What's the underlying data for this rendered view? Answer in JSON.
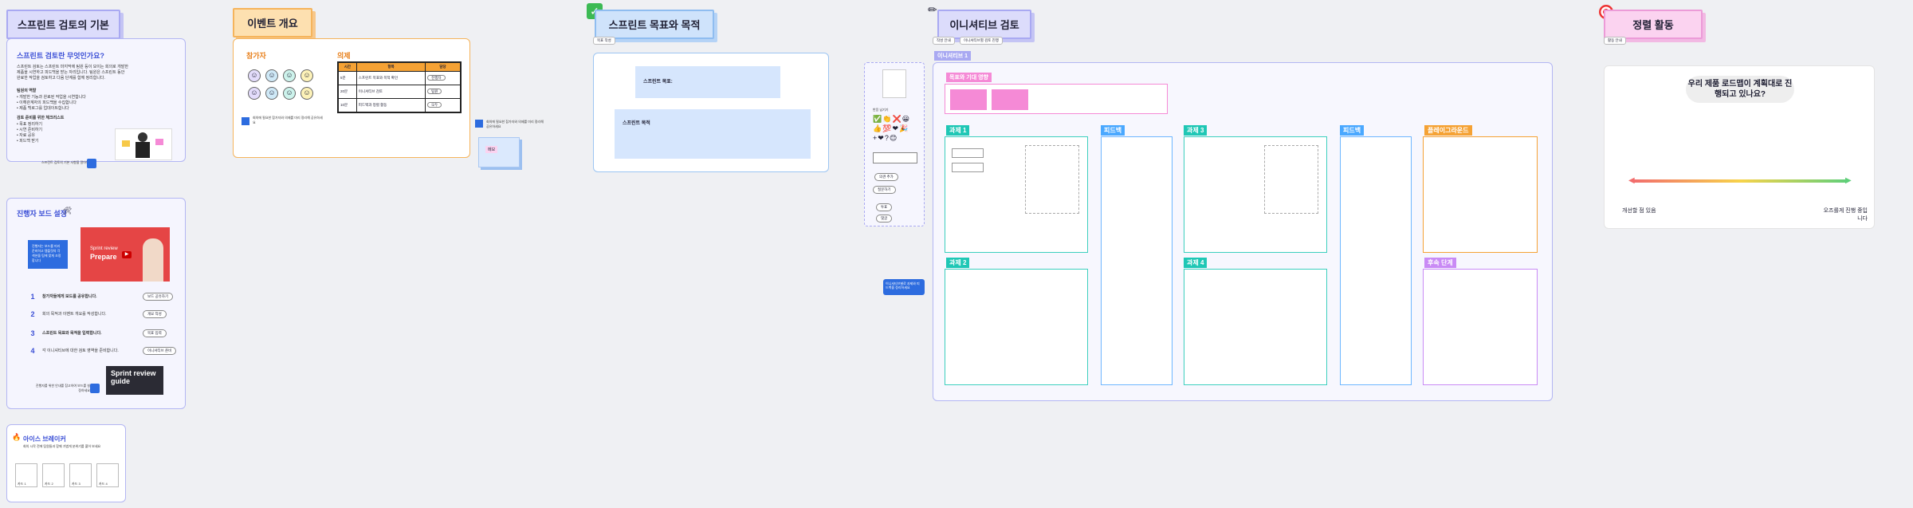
{
  "sections": {
    "basics": {
      "title": "스프린트 검토의 기본",
      "what_title": "스프린트 검토란 무엇인가요?",
      "what_body": "스프린트 검토는 스프린트 마지막에 팀원 등이 모이는 회의로 개발한 제품을 시연하고 피드백을 받는 자리입니다. 팀원은 스프린트 동안 완료한 작업을 검토하고 다음 단계를 함께 정리합니다.",
      "roles_title": "팀원의 역할",
      "roles_body": "• 개발한 기능과 완료된 작업을 시연합니다\n• 이해관계자의 피드백을 수집합니다\n• 제품 백로그를 업데이트합니다",
      "prep_title": "검토 준비를 위한 체크리스트",
      "prep_items": [
        "• 목표 정리하기",
        "• 시연 준비하기",
        "• 자료 공유",
        "• 피드백 받기"
      ],
      "hint": "스프린트 검토의 기본 사항을 알아보세요"
    },
    "facilitator": {
      "title": "진행자 보드 설정",
      "video_sub": "Sprint review",
      "video_main": "Prepare",
      "blue_note": "진행자는 보드를 미리 준비하고 템플릿의 각 섹션을 팀에 맞게 조정합니다",
      "steps": [
        {
          "n": "1",
          "text": "참가자들에게 보드를 공유합니다.",
          "btn": "보드 공유하기"
        },
        {
          "n": "2",
          "text": "회의 목적과 이벤트 개요를 작성합니다.",
          "btn": "개요 작성"
        },
        {
          "n": "3",
          "text": "스프린트 목표와 목적을 입력합니다.",
          "btn": "목표 입력"
        },
        {
          "n": "4",
          "text": "각 이니셔티브에 대한 검토 영역을 준비합니다.",
          "btn": "이니셔티브 준비"
        }
      ],
      "guide_title": "Sprint review guide",
      "hint": "진행자를 위한 안내를 참고하여 보드를 설정하세요"
    },
    "iceberg": {
      "title": "아이스 브레이커",
      "body": "회의 시작 전에 팀원들과 함께 가볍게 분위기를 풀어 보세요",
      "cards": [
        "카드 1",
        "카드 2",
        "카드 3",
        "카드 4"
      ]
    },
    "overview": {
      "title": "이벤트 개요",
      "participants": "참가자",
      "agenda": "의제",
      "table_headers": [
        "시간",
        "항목",
        "담당"
      ],
      "table_rows": [
        [
          "5분",
          "스프린트 목표와 목적 확인",
          "진행자"
        ],
        [
          "20분",
          "이니셔티브 검토",
          "팀원"
        ],
        [
          "10분",
          "피드백과 정렬 활동",
          "모두"
        ]
      ],
      "side_note": "회의에 필요한 참가자와 의제를 미리 정리해 공유하세요",
      "sticky_note": "메모"
    },
    "goals": {
      "title": "스프린트 목표와 목적",
      "tag": "목표 작성",
      "goal_label": "스프린트 목표:",
      "purpose_label": "스프린트 목적"
    },
    "initiative": {
      "title": "이니셔티브 검토",
      "tags": [
        "작성 안내",
        "이니셔티브별 검토 진행"
      ],
      "badge": "이니셔티브 1",
      "context_label": "목표와 기대 영향",
      "tasks": [
        "과제 1",
        "과제 2",
        "과제 3",
        "과제 4"
      ],
      "feedback": "피드백",
      "playground": "플레이그라운드",
      "next_steps": "후속 단계",
      "reaction_label": "반응 남기기",
      "emojis": [
        "✅",
        "👏",
        "❌",
        "😀",
        "👍",
        "💯",
        "❤",
        "🎉",
        "+",
        "❤",
        "?",
        "😊"
      ],
      "side_buttons": [
        "의견 추가",
        "질문하기",
        "투표",
        "댓글"
      ],
      "side_note": "이니셔티브별로 과제와 피드백을 정리하세요"
    },
    "alignment": {
      "title": "정렬 활동",
      "tag": "활동 안내",
      "question": "우리 제품 로드맵이 계획대로 진행되고 있나요?",
      "left": "개선할 점 있음",
      "right": "오즈를게 진행 중입니다"
    }
  },
  "icons": {
    "goal_icon": "check-icon",
    "initiative_icon": "pencil-icon",
    "alignment_icon": "target-icon"
  },
  "colors": {
    "accent": "#3b4fd6",
    "teal": "#1fc7b5",
    "blue": "#4aa8ff",
    "orange": "#f5a234",
    "pink": "#f58ad6"
  }
}
